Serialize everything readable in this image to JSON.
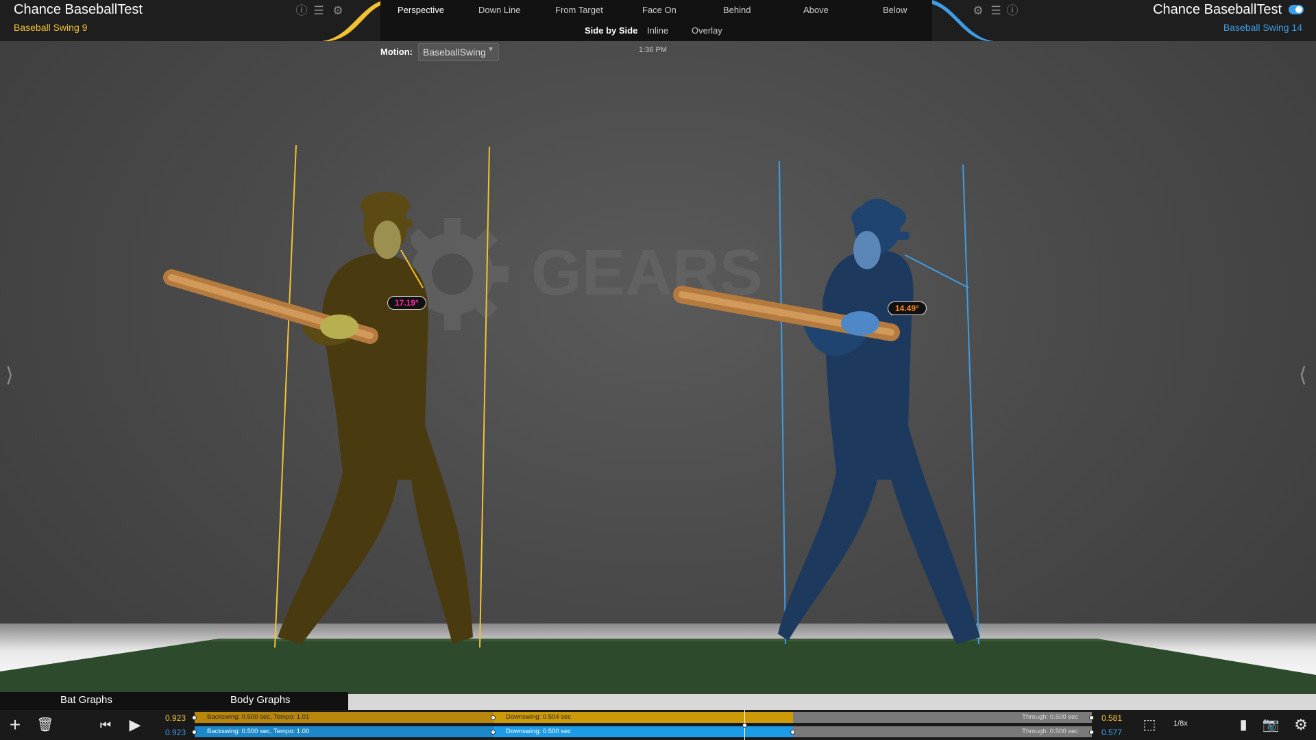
{
  "left_player": {
    "name": "Chance BaseballTest",
    "swing": "Baseball Swing 9",
    "color": "#f2c230"
  },
  "right_player": {
    "name": "Chance BaseballTest",
    "swing": "Baseball Swing 14",
    "color": "#3d9de6"
  },
  "view_tabs": [
    "Perspective",
    "Down Line",
    "From Target",
    "Face On",
    "Behind",
    "Above",
    "Below"
  ],
  "active_view": "Perspective",
  "layout_tabs": [
    "Side by Side",
    "Inline",
    "Overlay"
  ],
  "active_layout": "Side by Side",
  "motion": {
    "label": "Motion:",
    "value": "BaseballSwing"
  },
  "time": "1:36 PM",
  "watermark": "GEARS",
  "angles": {
    "left": "17.19°",
    "right": "14.49°"
  },
  "graph_tabs": {
    "bat": "Bat Graphs",
    "body": "Body Graphs"
  },
  "timeline": {
    "left": {
      "start": "0.923",
      "backswing": "Backswing: 0.500 sec, Tempo: 1.01",
      "downswing": "Downswing: 0.504 sec",
      "through": "Through: 0.500 sec",
      "end": "0.581"
    },
    "right": {
      "start": "0.923",
      "backswing": "Backswing: 0.500 sec, Tempo: 1.00",
      "downswing": "Downswing: 0.500 sec",
      "through": "Through: 0.500 sec",
      "end": "0.577"
    }
  },
  "speed": "1/8x",
  "icons": [
    "info-icon",
    "list-icon",
    "gear-icon",
    "plus-icon",
    "trash-icon",
    "skip-back-icon",
    "play-icon",
    "frame-icon",
    "document-icon",
    "camera-icon",
    "settings-icon"
  ]
}
